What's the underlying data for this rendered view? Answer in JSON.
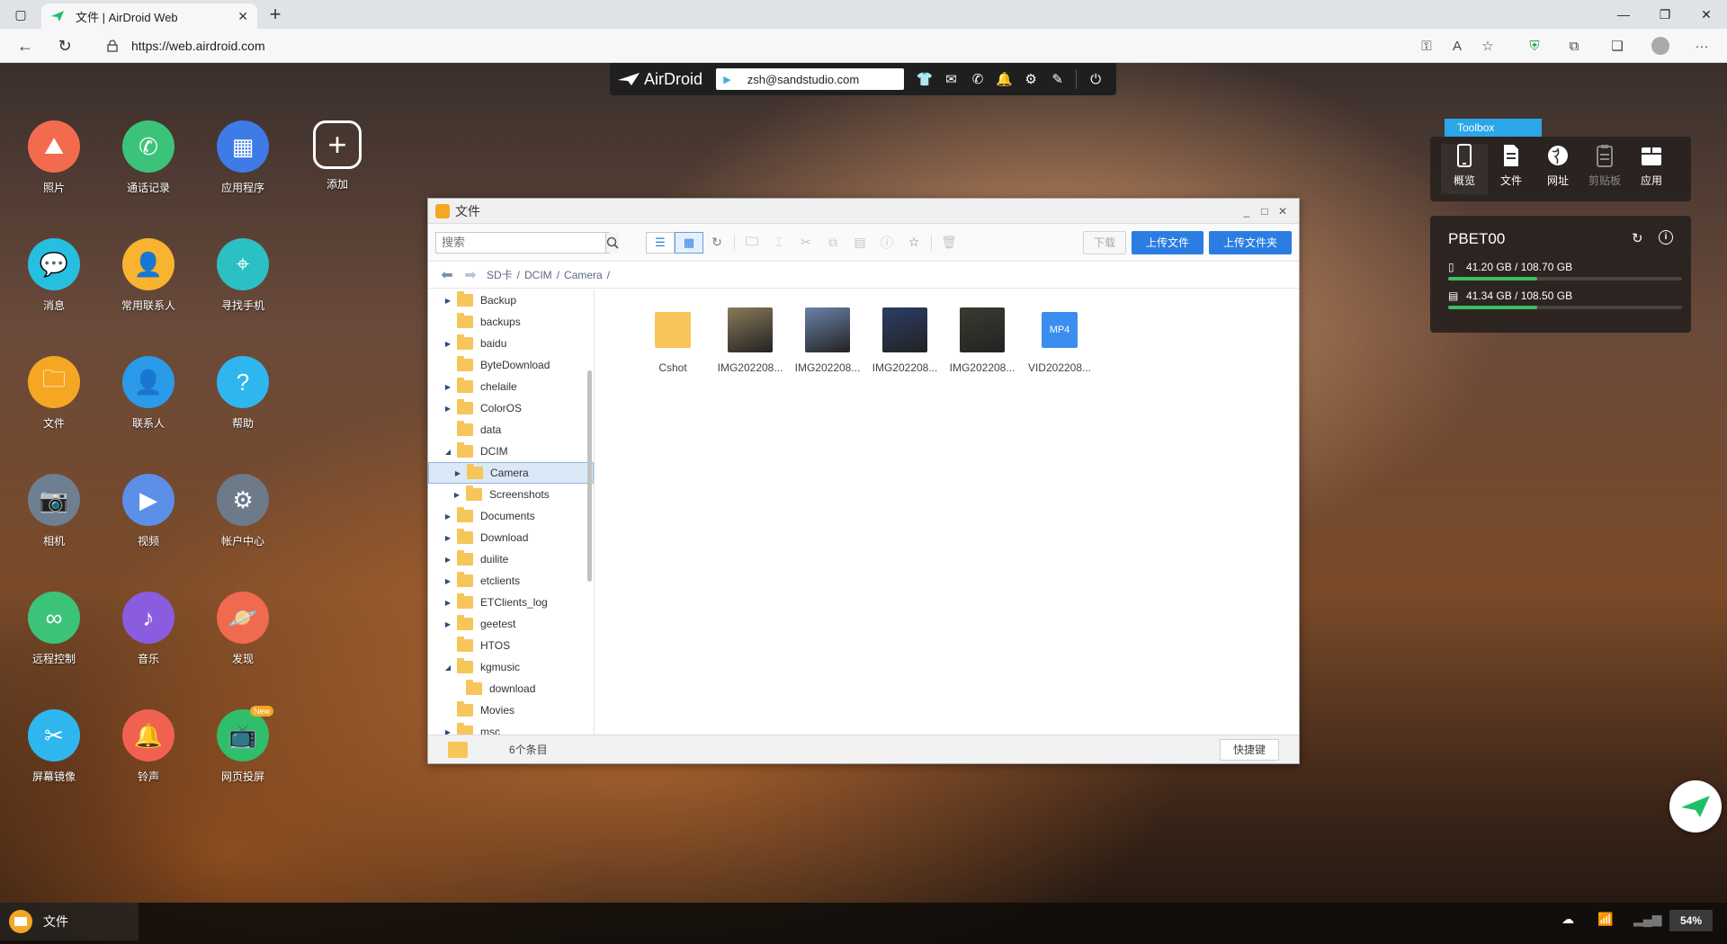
{
  "browser": {
    "tab_title": "文件 | AirDroid Web",
    "url": "https://web.airdroid.com"
  },
  "airdroid": {
    "logo": "AirDroid",
    "account": "zsh@sandstudio.com"
  },
  "apps": [
    {
      "label": "照片",
      "color": "#f26b4f",
      "icon": "photo-icon"
    },
    {
      "label": "通话记录",
      "color": "#3cc37a",
      "icon": "phone-icon"
    },
    {
      "label": "应用程序",
      "color": "#3e7be6",
      "icon": "apps-icon"
    },
    {
      "label": "添加",
      "color": "transparent",
      "icon": "add-icon"
    },
    {
      "label": "消息",
      "color": "#27bfe0",
      "icon": "message-icon"
    },
    {
      "label": "常用联系人",
      "color": "#f8b32f",
      "icon": "contacts-star-icon"
    },
    {
      "label": "寻找手机",
      "color": "#2bc0c4",
      "icon": "location-icon"
    },
    {
      "label": "文件",
      "color": "#f5a623",
      "icon": "folder-icon"
    },
    {
      "label": "联系人",
      "color": "#2b9ae8",
      "icon": "contact-icon"
    },
    {
      "label": "帮助",
      "color": "#2fb6ef",
      "icon": "help-icon"
    },
    {
      "label": "相机",
      "color": "#6e7f91",
      "icon": "camera-icon"
    },
    {
      "label": "视频",
      "color": "#5b8fe8",
      "icon": "video-icon"
    },
    {
      "label": "帐户中心",
      "color": "#6c7a8a",
      "icon": "gear-icon"
    },
    {
      "label": "远程控制",
      "color": "#3cc37a",
      "icon": "binocular-icon"
    },
    {
      "label": "音乐",
      "color": "#8a5ce0",
      "icon": "music-icon"
    },
    {
      "label": "发现",
      "color": "#ef6a4f",
      "icon": "planet-icon"
    },
    {
      "label": "屏幕镜像",
      "color": "#2fb6ef",
      "icon": "scissors-icon"
    },
    {
      "label": "铃声",
      "color": "#f0624f",
      "icon": "bell-icon"
    },
    {
      "label": "网页投屏",
      "color": "#2fbf6a",
      "icon": "cast-icon",
      "badge": "New"
    }
  ],
  "toolbox": {
    "tag": "Toolbox",
    "items": [
      {
        "label": "概览",
        "state": "active"
      },
      {
        "label": "文件",
        "state": "normal"
      },
      {
        "label": "网址",
        "state": "normal"
      },
      {
        "label": "剪贴板",
        "state": "disabled"
      },
      {
        "label": "应用",
        "state": "normal"
      }
    ]
  },
  "device": {
    "name": "PBET00",
    "storage": [
      {
        "text": "41.20 GB / 108.70 GB",
        "fill": 0.379
      },
      {
        "text": "41.34 GB / 108.50 GB",
        "fill": 0.381
      }
    ]
  },
  "files_window": {
    "title": "文件",
    "search_placeholder": "搜索",
    "download_label": "下载",
    "upload_file_label": "上传文件",
    "upload_folder_label": "上传文件夹",
    "breadcrumb": [
      "SD卡",
      "DCIM",
      "Camera"
    ],
    "tree": [
      {
        "label": "Backup",
        "depth": 0,
        "toggle": "collapsed"
      },
      {
        "label": "backups",
        "depth": 0,
        "toggle": "none"
      },
      {
        "label": "baidu",
        "depth": 0,
        "toggle": "collapsed"
      },
      {
        "label": "ByteDownload",
        "depth": 0,
        "toggle": "none"
      },
      {
        "label": "chelaile",
        "depth": 0,
        "toggle": "collapsed"
      },
      {
        "label": "ColorOS",
        "depth": 0,
        "toggle": "collapsed"
      },
      {
        "label": "data",
        "depth": 0,
        "toggle": "none"
      },
      {
        "label": "DCIM",
        "depth": 0,
        "toggle": "expanded"
      },
      {
        "label": "Camera",
        "depth": 1,
        "toggle": "collapsed",
        "selected": true
      },
      {
        "label": "Screenshots",
        "depth": 1,
        "toggle": "collapsed"
      },
      {
        "label": "Documents",
        "depth": 0,
        "toggle": "collapsed"
      },
      {
        "label": "Download",
        "depth": 0,
        "toggle": "collapsed"
      },
      {
        "label": "duilite",
        "depth": 0,
        "toggle": "collapsed"
      },
      {
        "label": "etclients",
        "depth": 0,
        "toggle": "collapsed"
      },
      {
        "label": "ETClients_log",
        "depth": 0,
        "toggle": "collapsed"
      },
      {
        "label": "geetest",
        "depth": 0,
        "toggle": "collapsed"
      },
      {
        "label": "HTOS",
        "depth": 0,
        "toggle": "none"
      },
      {
        "label": "kgmusic",
        "depth": 0,
        "toggle": "expanded"
      },
      {
        "label": "download",
        "depth": 1,
        "toggle": "none"
      },
      {
        "label": "Movies",
        "depth": 0,
        "toggle": "none"
      },
      {
        "label": "msc",
        "depth": 0,
        "toggle": "collapsed"
      }
    ],
    "items": [
      {
        "name": "Cshot",
        "kind": "folder"
      },
      {
        "name": "IMG202208...",
        "kind": "image",
        "tone": "#8a7a5a"
      },
      {
        "name": "IMG202208...",
        "kind": "image",
        "tone": "#6a83a8"
      },
      {
        "name": "IMG202208...",
        "kind": "image",
        "tone": "#2b3d66"
      },
      {
        "name": "IMG202208...",
        "kind": "image",
        "tone": "#3b3a30"
      },
      {
        "name": "VID202208...",
        "kind": "video",
        "badge": "MP4"
      }
    ],
    "status": "6个条目",
    "shortcut_label": "快捷键"
  },
  "taskbar": {
    "app_label": "文件",
    "battery": "54%"
  }
}
